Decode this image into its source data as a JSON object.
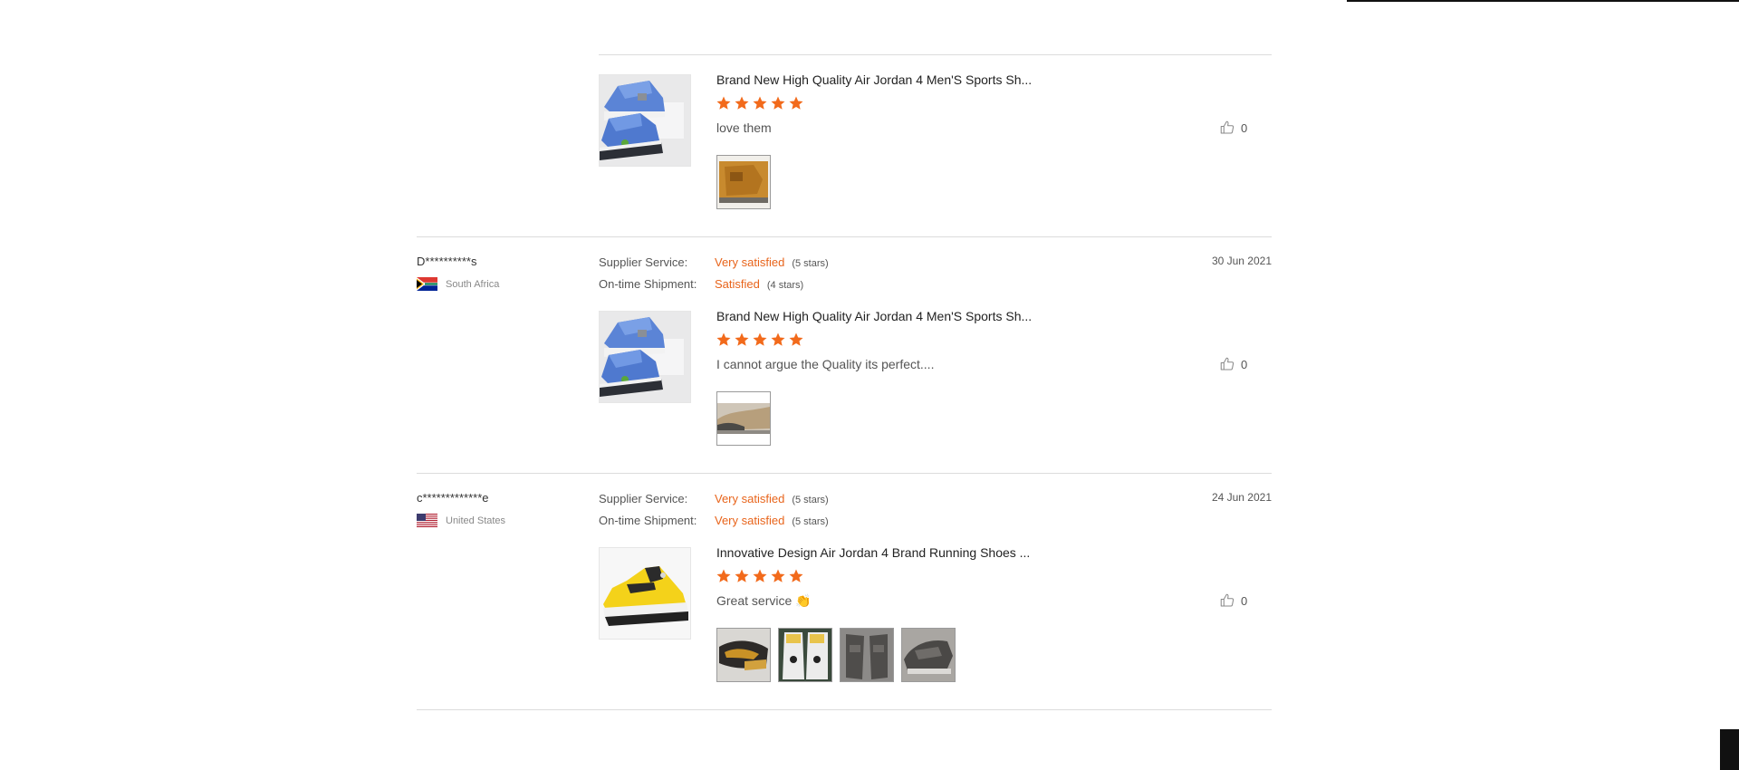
{
  "reviews": [
    {
      "buyer": "",
      "country": "",
      "date": "",
      "product_title": "Brand New High Quality Air Jordan 4 Men'S Sports Sh...",
      "product_rating": 5,
      "comment": "love them",
      "likes": "0",
      "photos": 1
    },
    {
      "buyer": "D**********s",
      "country": "South Africa",
      "date": "30 Jun 2021",
      "supplier_label": "Supplier Service:",
      "supplier_value": "Very satisfied",
      "supplier_stars": "(5 stars)",
      "shipment_label": "On-time Shipment:",
      "shipment_value": "Satisfied",
      "shipment_stars": "(4 stars)",
      "product_title": "Brand New High Quality Air Jordan 4 Men'S Sports Sh...",
      "product_rating": 5,
      "comment": "I cannot argue the Quality its perfect....",
      "likes": "0",
      "photos": 1
    },
    {
      "buyer": "c*************e",
      "country": "United States",
      "date": "24 Jun 2021",
      "supplier_label": "Supplier Service:",
      "supplier_value": "Very satisfied",
      "supplier_stars": "(5 stars)",
      "shipment_label": "On-time Shipment:",
      "shipment_value": "Very satisfied",
      "shipment_stars": "(5 stars)",
      "product_title": "Innovative Design Air Jordan 4 Brand Running Shoes ...",
      "product_rating": 5,
      "comment": "Great service 👏",
      "likes": "0",
      "photos": 4
    }
  ],
  "colors": {
    "accent": "#e8641b",
    "star": "#f26a1b",
    "divider": "#dcdcdc"
  },
  "icons": {
    "like": "thumbs-up-icon",
    "star": "star-icon"
  }
}
